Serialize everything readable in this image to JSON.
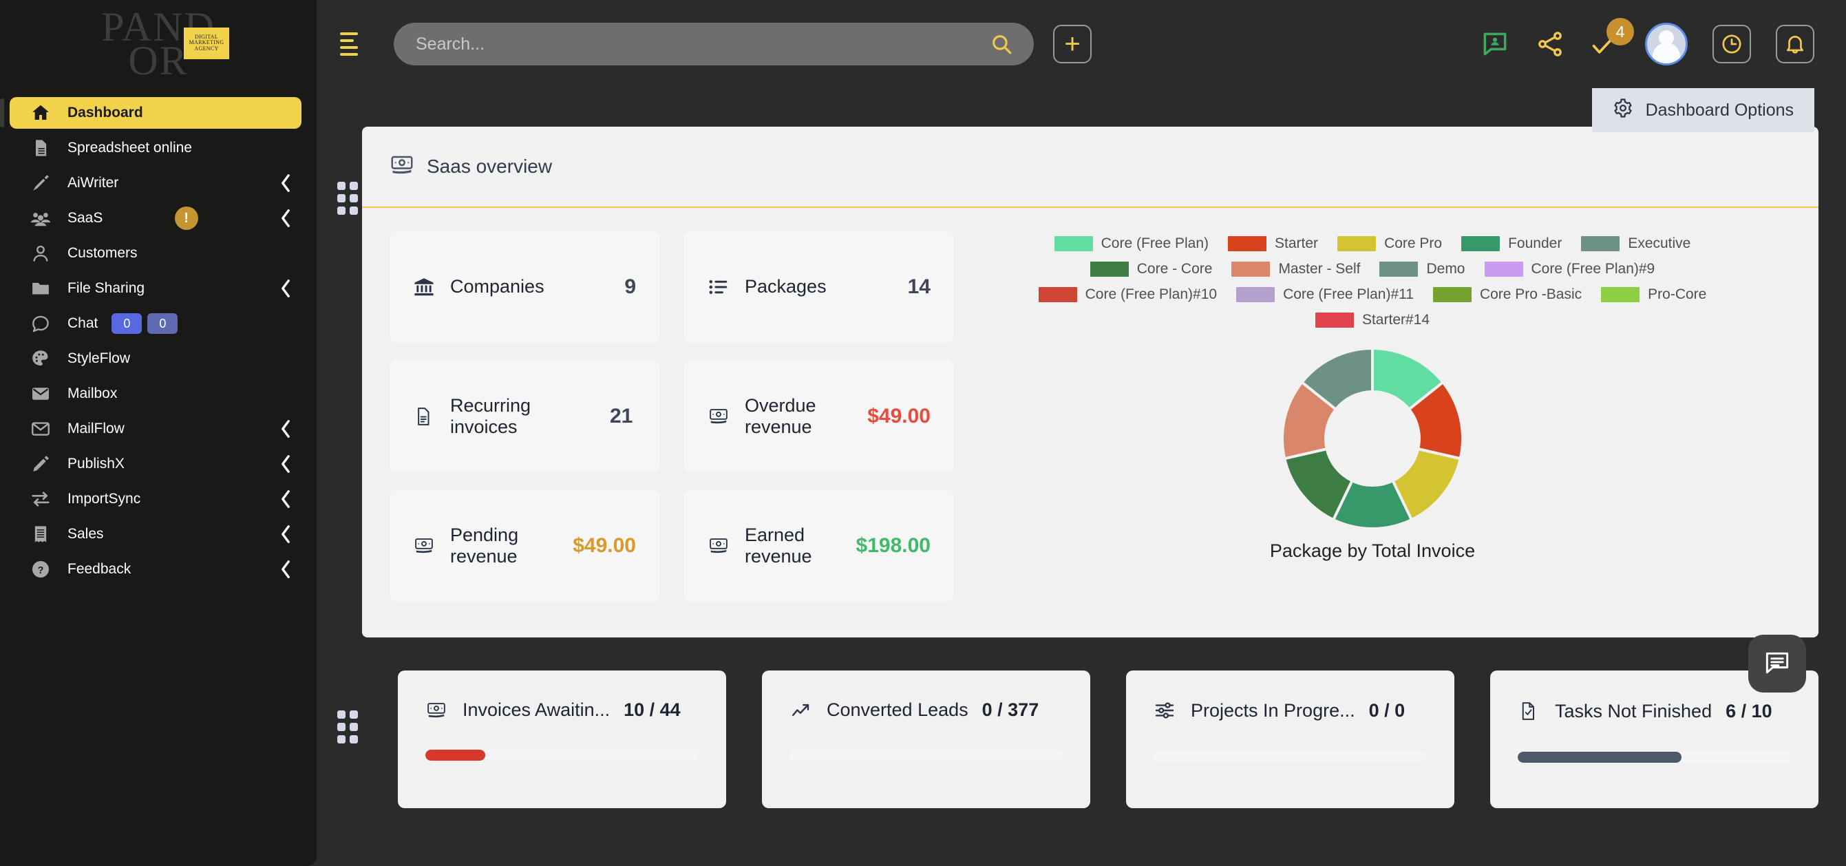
{
  "sidebar": {
    "brand": {
      "line1": "PAND",
      "line2": "OR",
      "chip_lines": "DIGITAL MARKETING AGENCY"
    },
    "items": [
      {
        "label": "Dashboard",
        "icon": "home-icon",
        "active": true,
        "chevron": false
      },
      {
        "label": "Spreadsheet online",
        "icon": "document-icon",
        "active": false,
        "chevron": false
      },
      {
        "label": "AiWriter",
        "icon": "pen-nib-icon",
        "active": false,
        "chevron": true
      },
      {
        "label": "SaaS",
        "icon": "people-icon",
        "active": false,
        "chevron": true,
        "warn": "!"
      },
      {
        "label": "Customers",
        "icon": "user-icon",
        "active": false,
        "chevron": false
      },
      {
        "label": "File Sharing",
        "icon": "folder-icon",
        "active": false,
        "chevron": true
      },
      {
        "label": "Chat",
        "icon": "chat-bubble-icon",
        "active": false,
        "chevron": false,
        "badge_a": "0",
        "badge_b": "0"
      },
      {
        "label": "StyleFlow",
        "icon": "palette-icon",
        "active": false,
        "chevron": false
      },
      {
        "label": "Mailbox",
        "icon": "mail-filled-icon",
        "active": false,
        "chevron": false
      },
      {
        "label": "MailFlow",
        "icon": "mail-outline-icon",
        "active": false,
        "chevron": true
      },
      {
        "label": "PublishX",
        "icon": "pencil-icon",
        "active": false,
        "chevron": true
      },
      {
        "label": "ImportSync",
        "icon": "transfer-icon",
        "active": false,
        "chevron": true
      },
      {
        "label": "Sales",
        "icon": "receipt-icon",
        "active": false,
        "chevron": true
      },
      {
        "label": "Feedback",
        "icon": "help-circle-icon",
        "active": false,
        "chevron": true
      }
    ]
  },
  "topbar": {
    "search": {
      "value": "",
      "placeholder": "Search..."
    },
    "add_label": "+",
    "notification_count": "4"
  },
  "dashboard_options": {
    "label": "Dashboard Options"
  },
  "saas_card": {
    "title": "Saas overview",
    "tiles": [
      {
        "label": "Companies",
        "value": "9",
        "tone": "plain",
        "icon": "bank-icon"
      },
      {
        "label": "Packages",
        "value": "14",
        "tone": "plain",
        "icon": "list-icon"
      },
      {
        "label": "Recurring invoices",
        "value": "21",
        "tone": "plain",
        "icon": "invoice-icon"
      },
      {
        "label": "Overdue revenue",
        "value": "$49.00",
        "tone": "red",
        "icon": "money-icon"
      },
      {
        "label": "Pending revenue",
        "value": "$49.00",
        "tone": "amber",
        "icon": "money-icon"
      },
      {
        "label": "Earned revenue",
        "value": "$198.00",
        "tone": "green",
        "icon": "money-icon"
      }
    ]
  },
  "chart_data": {
    "type": "pie",
    "title": "Package by Total Invoice",
    "legend_position": "top",
    "labels": [
      "Core (Free Plan)",
      "Starter",
      "Core Pro",
      "Founder",
      "Executive",
      "Core - Core",
      "Master - Self",
      "Demo",
      "Core (Free Plan)#9",
      "Core (Free Plan)#10",
      "Core (Free Plan)#11",
      "Core Pro -Basic",
      "Pro-Core",
      "Starter#14"
    ],
    "colors": [
      "#62dda2",
      "#d8431d",
      "#d4c432",
      "#37996a",
      "#6d9185",
      "#3d7d43",
      "#d9866a",
      "#6d9185",
      "#c69bf0",
      "#cf4634",
      "#b3a0cf",
      "#76a330",
      "#8ccf43",
      "#e0434a"
    ],
    "values": [
      1,
      1,
      1,
      1,
      1,
      1,
      1,
      0,
      0,
      0,
      0,
      0,
      0,
      0
    ],
    "rendered_slices": [
      {
        "label": "Core (Free Plan)",
        "color": "#62dda2",
        "share": 0.1428
      },
      {
        "label": "Starter",
        "color": "#d8431d",
        "share": 0.1428
      },
      {
        "label": "Core Pro",
        "color": "#d4c432",
        "share": 0.1428
      },
      {
        "label": "Founder",
        "color": "#37996a",
        "share": 0.1428
      },
      {
        "label": "Core - Core",
        "color": "#3d7d43",
        "share": 0.1428
      },
      {
        "label": "Master - Self",
        "color": "#d9866a",
        "share": 0.1428
      },
      {
        "label": "Executive",
        "color": "#6d9185",
        "share": 0.1428
      }
    ],
    "legend_rows": [
      [
        {
          "label": "Core (Free Plan)",
          "color": "#62dda2"
        },
        {
          "label": "Starter",
          "color": "#d8431d"
        },
        {
          "label": "Core Pro",
          "color": "#d4c432"
        },
        {
          "label": "Founder",
          "color": "#37996a"
        },
        {
          "label": "Executive",
          "color": "#6d9185"
        }
      ],
      [
        {
          "label": "Core - Core",
          "color": "#3d7d43"
        },
        {
          "label": "Master - Self",
          "color": "#d9866a"
        },
        {
          "label": "Demo",
          "color": "#6d9185"
        },
        {
          "label": "Core (Free Plan)#9",
          "color": "#c69bf0"
        }
      ],
      [
        {
          "label": "Core (Free Plan)#10",
          "color": "#cf4634"
        },
        {
          "label": "Core (Free Plan)#11",
          "color": "#b3a0cf"
        },
        {
          "label": "Core Pro -Basic",
          "color": "#76a330"
        },
        {
          "label": "Pro-Core",
          "color": "#8ccf43"
        }
      ],
      [
        {
          "label": "Starter#14",
          "color": "#e0434a"
        }
      ]
    ]
  },
  "bottom_cards": [
    {
      "label": "Invoices Awaitin...",
      "value": "10 / 44",
      "percent": 22,
      "bar_color": "#d6392c",
      "icon": "money-icon"
    },
    {
      "label": "Converted Leads",
      "value": "0 / 377",
      "percent": 0,
      "bar_color": "#d6392c",
      "icon": "trend-up-icon"
    },
    {
      "label": "Projects In Progre...",
      "value": "0 / 0",
      "percent": 0,
      "bar_color": "#d6392c",
      "icon": "sliders-icon"
    },
    {
      "label": "Tasks Not Finished",
      "value": "6 / 10",
      "percent": 60,
      "bar_color": "#4e5868",
      "icon": "task-check-icon"
    }
  ],
  "colors": {
    "accent": "#f2d14b",
    "sidebar_bg": "#191917",
    "page_bg": "#2b2b2b",
    "card_bg": "#f1f1f1"
  }
}
